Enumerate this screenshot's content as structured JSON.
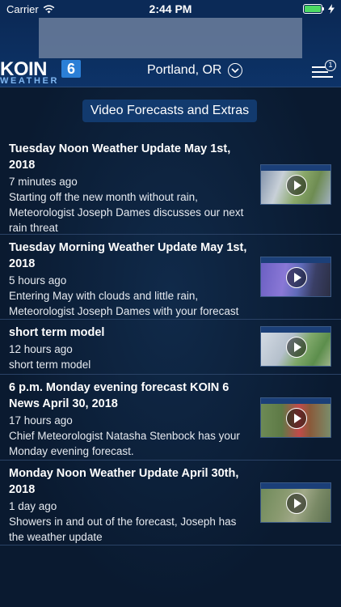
{
  "status_bar": {
    "carrier": "Carrier",
    "time": "2:44 PM",
    "battery_level": 1.0
  },
  "header": {
    "logo_main": "KOIN",
    "logo_number": "6",
    "logo_sub": "WEATHER",
    "location": "Portland, OR",
    "menu_badge": "1"
  },
  "section": {
    "title": "Video Forecasts and Extras"
  },
  "videos": [
    {
      "title": "Tuesday Noon Weather Update May 1st, 2018",
      "time": "7 minutes ago",
      "description": "Starting off the new month without rain, Meteorologist Joseph Dames discusses our next rain threat"
    },
    {
      "title": "Tuesday Morning Weather Update May 1st, 2018",
      "time": "5 hours ago",
      "description": "Entering May with clouds and little rain, Meteorologist Joseph Dames with your forecast"
    },
    {
      "title": "short term model",
      "time": "12 hours ago",
      "description": "short term model"
    },
    {
      "title": "6 p.m. Monday evening forecast KOIN 6 News April 30, 2018",
      "time": "17 hours ago",
      "description": "Chief Meteorologist Natasha Stenbock has your Monday evening forecast."
    },
    {
      "title": "Monday Noon Weather Update April 30th, 2018",
      "time": "1 day ago",
      "description": "Showers in and out of the forecast, Joseph has the weather update"
    }
  ],
  "colors": {
    "header_bg": "#0b2a57",
    "background": "#0a1a30",
    "accent": "#2b7fd6",
    "battery": "#4cd964"
  }
}
